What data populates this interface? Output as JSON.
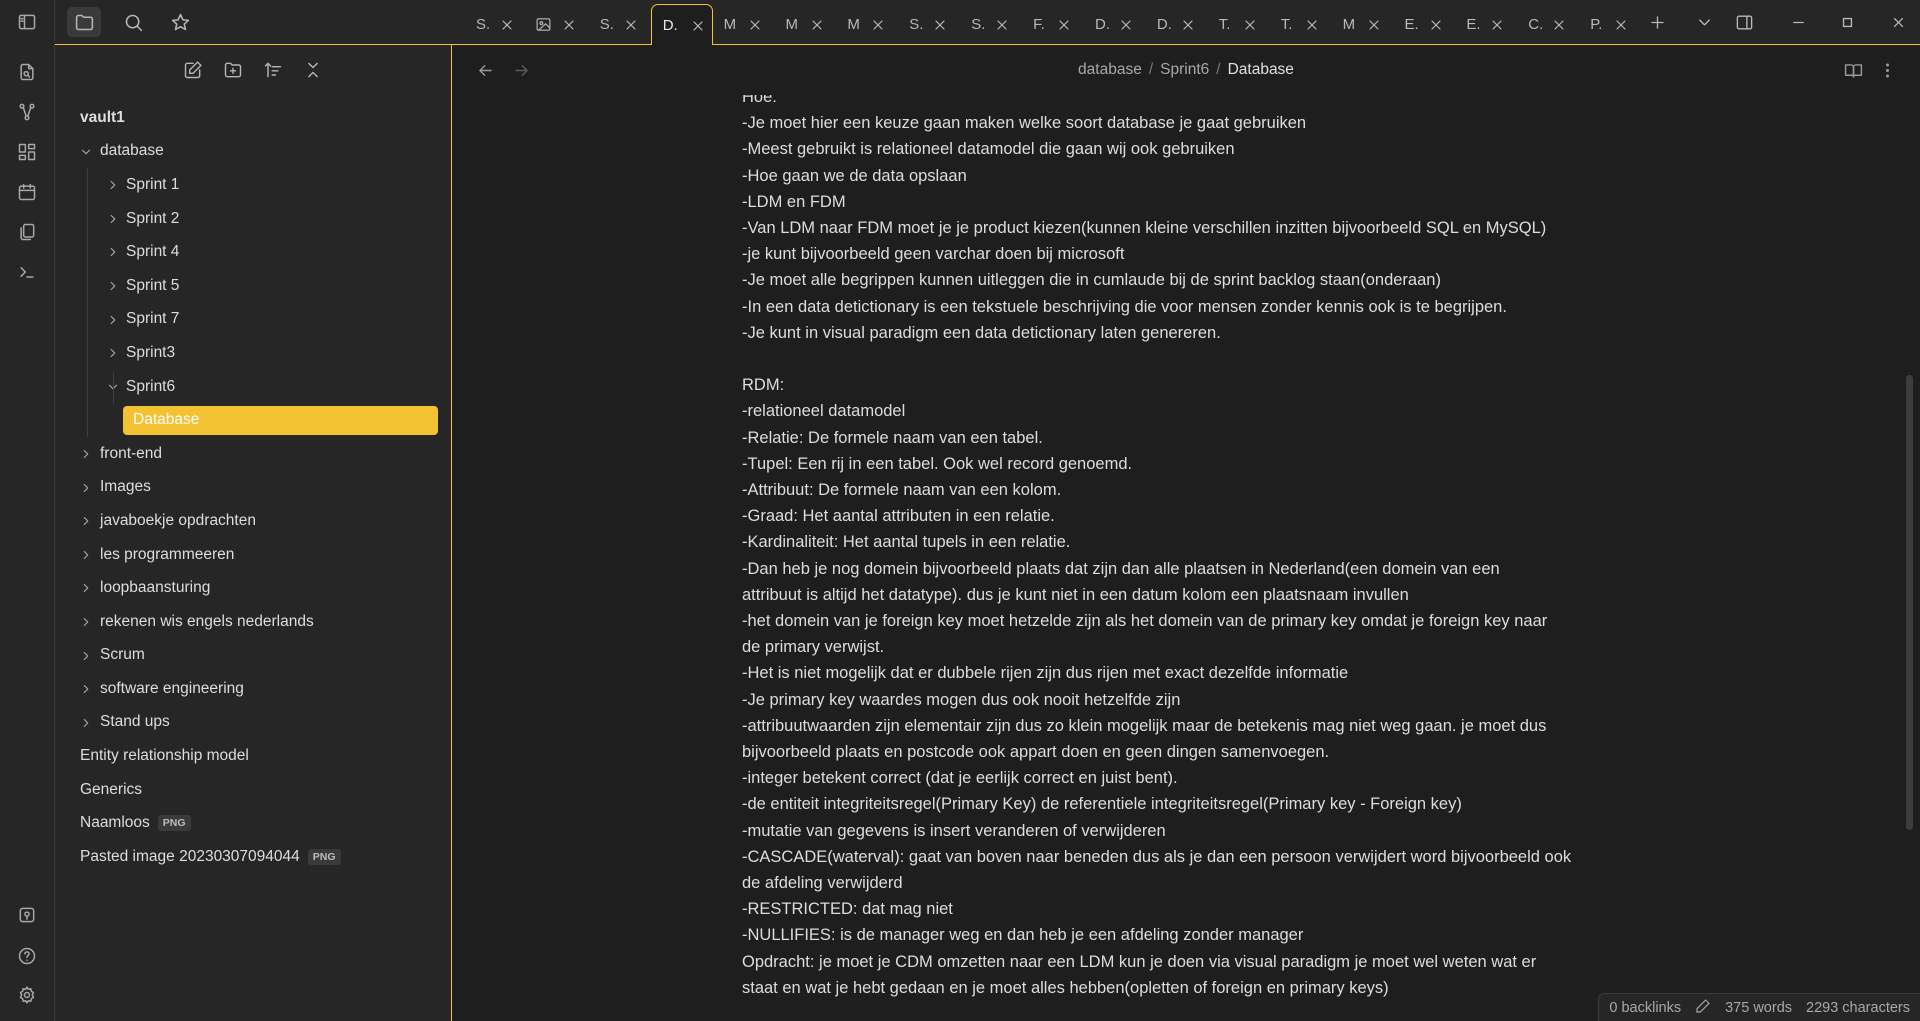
{
  "sidebar": {
    "vault_name": "vault1",
    "items": [
      {
        "label": "database",
        "depth": 0,
        "type": "folder",
        "open": true
      },
      {
        "label": "Sprint 1",
        "depth": 1,
        "type": "folder",
        "open": false
      },
      {
        "label": "Sprint 2",
        "depth": 1,
        "type": "folder",
        "open": false
      },
      {
        "label": "Sprint 4",
        "depth": 1,
        "type": "folder",
        "open": false
      },
      {
        "label": "Sprint 5",
        "depth": 1,
        "type": "folder",
        "open": false
      },
      {
        "label": "Sprint 7",
        "depth": 1,
        "type": "folder",
        "open": false
      },
      {
        "label": "Sprint3",
        "depth": 1,
        "type": "folder",
        "open": false
      },
      {
        "label": "Sprint6",
        "depth": 1,
        "type": "folder",
        "open": true
      },
      {
        "label": "Database",
        "depth": 2,
        "type": "file",
        "selected": true
      },
      {
        "label": "front-end",
        "depth": 0,
        "type": "folder",
        "open": false
      },
      {
        "label": "Images",
        "depth": 0,
        "type": "folder",
        "open": false
      },
      {
        "label": "javaboekje opdrachten",
        "depth": 0,
        "type": "folder",
        "open": false
      },
      {
        "label": "les programmeeren",
        "depth": 0,
        "type": "folder",
        "open": false
      },
      {
        "label": "loopbaansturing",
        "depth": 0,
        "type": "folder",
        "open": false
      },
      {
        "label": "rekenen wis engels nederlands",
        "depth": 0,
        "type": "folder",
        "open": false
      },
      {
        "label": "Scrum",
        "depth": 0,
        "type": "folder",
        "open": false
      },
      {
        "label": "software engineering",
        "depth": 0,
        "type": "folder",
        "open": false
      },
      {
        "label": "Stand ups",
        "depth": 0,
        "type": "folder",
        "open": false
      },
      {
        "label": "Entity relationship model",
        "depth": 0,
        "type": "file"
      },
      {
        "label": "Generics",
        "depth": 0,
        "type": "file"
      },
      {
        "label": "Naamloos",
        "depth": 0,
        "type": "file",
        "badge": "PNG"
      },
      {
        "label": "Pasted image 20230307094044",
        "depth": 0,
        "type": "file",
        "badge": "PNG"
      }
    ]
  },
  "tabs": [
    {
      "label": "S.",
      "active": false
    },
    {
      "label": "",
      "icon": "image-icon",
      "active": false
    },
    {
      "label": "S.",
      "active": false
    },
    {
      "label": "D.",
      "active": true
    },
    {
      "label": "M",
      "active": false
    },
    {
      "label": "M",
      "active": false
    },
    {
      "label": "M",
      "active": false
    },
    {
      "label": "S.",
      "active": false
    },
    {
      "label": "S.",
      "active": false
    },
    {
      "label": "F.",
      "active": false
    },
    {
      "label": "D.",
      "active": false
    },
    {
      "label": "D.",
      "active": false
    },
    {
      "label": "T.",
      "active": false
    },
    {
      "label": "T.",
      "active": false
    },
    {
      "label": "M",
      "active": false
    },
    {
      "label": "E.",
      "active": false
    },
    {
      "label": "E.",
      "active": false
    },
    {
      "label": "C.",
      "active": false
    },
    {
      "label": "P.",
      "active": false
    }
  ],
  "breadcrumb": {
    "parts": [
      "database",
      "Sprint6"
    ],
    "current": "Database",
    "separator": "/"
  },
  "document": {
    "lines": [
      "Hoe:",
      "-Je moet hier een keuze gaan maken welke soort database je gaat gebruiken",
      "-Meest gebruikt is relationeel datamodel die gaan wij ook gebruiken",
      "-Hoe gaan we de data opslaan",
      "-LDM en FDM",
      "-Van LDM naar FDM moet je je product kiezen(kunnen kleine verschillen inzitten bijvoorbeeld SQL en MySQL)",
      "-je kunt bijvoorbeeld geen varchar doen bij microsoft",
      "-Je moet alle begrippen kunnen uitleggen die in cumlaude bij de sprint backlog staan(onderaan)",
      "-In een data detictionary is een tekstuele beschrijving die voor mensen zonder kennis ook is te begrijpen.",
      "-Je kunt in visual paradigm een data detictionary laten genereren.",
      "",
      "RDM:",
      "-relationeel datamodel",
      "-Relatie: De formele naam van een tabel.",
      "-Tupel: Een rij in een tabel. Ook wel record genoemd.",
      "-Attribuut: De formele naam van een kolom.",
      "-Graad: Het aantal attributen in een relatie.",
      "-Kardinaliteit: Het aantal tupels in een relatie.",
      "-Dan heb je nog domein bijvoorbeeld plaats dat zijn dan alle plaatsen in Nederland(een domein van een",
      "attribuut is altijd het datatype). dus je kunt niet in een datum kolom een plaatsnaam invullen",
      "-het domein van je foreign key moet hetzelde zijn als het domein van de primary key omdat je foreign key naar",
      "de primary verwijst.",
      "-Het is niet mogelijk dat er dubbele rijen zijn dus rijen met exact dezelfde informatie",
      "-Je primary key waardes mogen dus ook nooit hetzelfde zijn",
      "-attribuutwaarden zijn elementair zijn dus zo klein mogelijk maar de betekenis mag niet weg gaan. je moet dus",
      "bijvoorbeeld plaats en postcode ook appart doen en geen dingen samenvoegen.",
      "-integer betekent correct (dat je eerlijk correct en juist bent).",
      "-de entiteit integriteitsregel(Primary Key) de referentiele integriteitsregel(Primary key - Foreign key)",
      "-mutatie van gegevens is insert veranderen of verwijderen",
      "-CASCADE(waterval): gaat van boven naar beneden dus als je dan een persoon verwijdert word bijvoorbeeld ook",
      "de afdeling verwijderd",
      "-RESTRICTED: dat mag niet",
      "-NULLIFIES: is de manager weg en dan heb je een afdeling zonder manager",
      "Opdracht: je moet je CDM omzetten naar een LDM kun je doen via visual paradigm je moet wel weten wat er",
      "staat en wat je hebt gedaan en je moet alles hebben(opletten of foreign en primary keys)"
    ]
  },
  "status": {
    "backlinks": "0 backlinks",
    "words": "375 words",
    "characters": "2293 characters"
  },
  "colors": {
    "accent": "#f2c233",
    "background": "#1e1e1e",
    "sidebar": "#262626"
  }
}
